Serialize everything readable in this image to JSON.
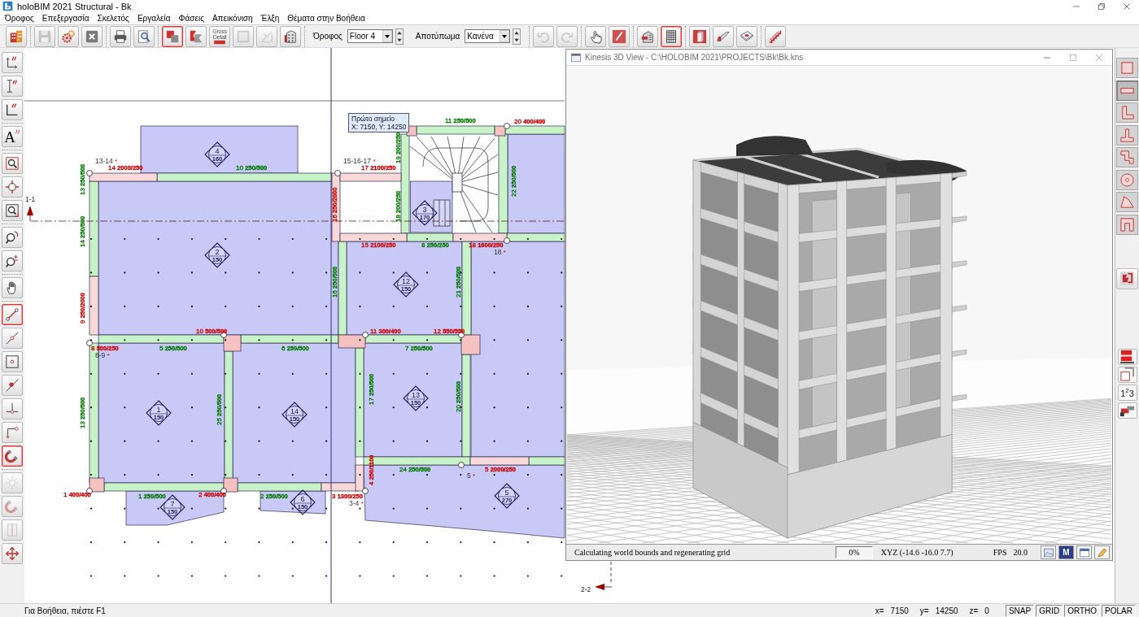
{
  "window": {
    "title": "holoBIM 2021 Structural - Bk"
  },
  "menu": [
    "Όροφος",
    "Επεξεργασία",
    "Σκελετός",
    "Εργαλεία",
    "Φάσεις",
    "Απεικόνιση",
    "Έλξη",
    "Θέματα στην Βοήθεια"
  ],
  "toolbar": [
    {
      "items": [
        {
          "kind": "building",
          "selected": false,
          "disabled": false
        }
      ]
    },
    {
      "items": [
        {
          "kind": "save",
          "selected": false,
          "disabled": true
        },
        {
          "kind": "gears",
          "selected": false,
          "disabled": false
        },
        {
          "kind": "delete",
          "selected": false,
          "disabled": false
        }
      ]
    },
    {
      "items": [
        {
          "kind": "print",
          "selected": false,
          "disabled": false
        },
        {
          "kind": "preview",
          "selected": false,
          "disabled": false
        }
      ]
    },
    {
      "items": [
        {
          "kind": "plan",
          "selected": true,
          "disabled": false
        },
        {
          "kind": "wedge",
          "selected": false,
          "disabled": false
        },
        {
          "kind": "gross",
          "label": "Gross Detail",
          "selected": false,
          "disabled": false
        },
        {
          "kind": "frame",
          "selected": false,
          "disabled": true
        },
        {
          "kind": "sketch",
          "selected": false,
          "disabled": true
        },
        {
          "kind": "facade",
          "selected": false,
          "disabled": false
        }
      ]
    },
    {
      "items": [
        {
          "kind": "combo",
          "label": "Όροφος",
          "value": "Floor 4"
        },
        {
          "kind": "combo",
          "label": "Αποτύπωμα",
          "value": "Κανένα"
        }
      ]
    },
    {
      "items": [
        {
          "kind": "undo",
          "selected": false,
          "disabled": true
        },
        {
          "kind": "redo",
          "selected": false,
          "disabled": true
        }
      ]
    },
    {
      "items": [
        {
          "kind": "hand",
          "selected": false,
          "disabled": false
        },
        {
          "kind": "pen",
          "selected": false,
          "disabled": false
        }
      ]
    },
    {
      "items": [
        {
          "kind": "section-view",
          "selected": false,
          "disabled": false
        },
        {
          "kind": "grid-view",
          "selected": true,
          "disabled": false
        }
      ]
    },
    {
      "items": [
        {
          "kind": "column",
          "selected": false,
          "disabled": false
        },
        {
          "kind": "beam",
          "selected": false,
          "disabled": false
        },
        {
          "kind": "slab",
          "selected": false,
          "disabled": false
        }
      ]
    },
    {
      "items": [
        {
          "kind": "stairs",
          "selected": false,
          "disabled": false
        }
      ]
    }
  ],
  "left_toolbar": [
    {
      "items": [
        {
          "kind": "dim-linear",
          "selected": false,
          "disabled": false
        },
        {
          "kind": "dim-vertical",
          "selected": false,
          "disabled": false
        },
        {
          "kind": "dim-angle",
          "selected": false,
          "disabled": false
        }
      ]
    },
    {
      "items": [
        {
          "kind": "text",
          "glyph": "A",
          "selected": false,
          "disabled": false
        }
      ]
    },
    {
      "items": [
        {
          "kind": "zoom-window",
          "selected": false,
          "disabled": false
        },
        {
          "kind": "zoom-center",
          "selected": false,
          "disabled": false
        },
        {
          "kind": "zoom-extents",
          "selected": false,
          "disabled": false
        }
      ]
    },
    {
      "items": [
        {
          "kind": "zoom-previous",
          "selected": false,
          "disabled": false
        },
        {
          "kind": "zoom-scale",
          "selected": false,
          "disabled": false
        }
      ]
    },
    {
      "items": [
        {
          "kind": "pan",
          "selected": false,
          "disabled": false
        }
      ]
    },
    {
      "items": [
        {
          "kind": "line",
          "selected": true,
          "disabled": false
        },
        {
          "kind": "line-mid",
          "selected": false,
          "disabled": false
        },
        {
          "kind": "center",
          "selected": false,
          "disabled": false
        },
        {
          "kind": "snap",
          "selected": false,
          "disabled": false
        },
        {
          "kind": "perpendicular",
          "selected": false,
          "disabled": false
        },
        {
          "kind": "corner",
          "selected": false,
          "disabled": false
        },
        {
          "kind": "magnet",
          "selected": true,
          "disabled": false
        }
      ]
    },
    {
      "items": [
        {
          "kind": "sun",
          "selected": false,
          "disabled": true
        },
        {
          "kind": "magnet-tool",
          "selected": false,
          "disabled": true
        },
        {
          "kind": "door",
          "selected": false,
          "disabled": true
        },
        {
          "kind": "move",
          "selected": false,
          "disabled": false
        }
      ]
    }
  ],
  "right_toolbar": [
    {
      "items": [
        {
          "kind": "rect-shape",
          "selected": false
        },
        {
          "kind": "bar-shape",
          "selected": true
        },
        {
          "kind": "l-shape",
          "selected": false
        },
        {
          "kind": "t-shape",
          "selected": false
        },
        {
          "kind": "z-shape",
          "selected": false
        },
        {
          "kind": "ring-shape",
          "selected": false
        },
        {
          "kind": "quad-shape",
          "selected": false
        },
        {
          "kind": "u-shape",
          "selected": false
        }
      ]
    },
    {
      "items": [
        {
          "kind": "section-cut",
          "selected": false
        }
      ]
    },
    {
      "items": [
        {
          "kind": "blocks",
          "selected": false
        },
        {
          "kind": "copy",
          "selected": false
        },
        {
          "kind": "numbering",
          "glyph": "1$^{2}$3",
          "selected": false
        },
        {
          "kind": "pipe",
          "selected": false
        }
      ]
    }
  ],
  "plan": {
    "sections": [
      "1-1",
      "2-2"
    ],
    "tooltip": {
      "title": "Πρώτο σημείο",
      "text": "X: 7150, Y: 14250"
    },
    "slabs": [
      {
        "number": "4",
        "thickness": "160"
      },
      {
        "number": "2",
        "thickness": "150"
      },
      {
        "number": "3",
        "thickness": "170"
      },
      {
        "number": "12",
        "thickness": "150"
      },
      {
        "number": "1",
        "thickness": "150"
      },
      {
        "number": "14",
        "thickness": "150"
      },
      {
        "number": "13",
        "thickness": "150"
      },
      {
        "number": "7",
        "thickness": "150"
      },
      {
        "number": "6",
        "thickness": "150"
      },
      {
        "number": "5",
        "thickness": "270"
      }
    ],
    "node_labels": [
      {
        "label": "13-14",
        "mark": "*"
      },
      {
        "label": "15-16-17",
        "mark": "*"
      },
      {
        "label": "8-9",
        "mark": "*"
      },
      {
        "label": "18",
        "mark": "*"
      },
      {
        "label": "5",
        "mark": "*"
      },
      {
        "label": "3-4",
        "mark": "*"
      }
    ],
    "member_labels": [
      {
        "number": "14",
        "size": "2000/250",
        "color": "#cc0000",
        "kind": "horizontal"
      },
      {
        "number": "10",
        "size": "250/500",
        "color": "#007a00",
        "kind": "horizontal"
      },
      {
        "number": "17",
        "size": "2100/250",
        "color": "#cc0000",
        "kind": "horizontal"
      },
      {
        "number": "11",
        "size": "250/500",
        "color": "#007a00",
        "kind": "horizontal"
      },
      {
        "number": "20",
        "size": "400/400",
        "color": "#cc0000",
        "kind": "horizontal"
      },
      {
        "number": "15",
        "size": "2100/250",
        "color": "#cc0000",
        "kind": "horizontal"
      },
      {
        "number": "8",
        "size": "250/250",
        "color": "#007a00",
        "kind": "horizontal"
      },
      {
        "number": "18",
        "size": "1600/250",
        "color": "#cc0000",
        "kind": "horizontal"
      },
      {
        "number": "10",
        "size": "500/500",
        "color": "#cc0000",
        "kind": "horizontal"
      },
      {
        "number": "11",
        "size": "300/400",
        "color": "#cc0000",
        "kind": "horizontal"
      },
      {
        "number": "12",
        "size": "550/550",
        "color": "#cc0000",
        "kind": "horizontal"
      },
      {
        "number": "8",
        "size": "500/250",
        "color": "#cc0000",
        "kind": "horizontal"
      },
      {
        "number": "5",
        "size": "250/500",
        "color": "#007a00",
        "kind": "horizontal"
      },
      {
        "number": "6",
        "size": "250/500",
        "color": "#007a00",
        "kind": "horizontal"
      },
      {
        "number": "7",
        "size": "250/500",
        "color": "#007a00",
        "kind": "horizontal"
      },
      {
        "number": "24",
        "size": "250/500",
        "color": "#007a00",
        "kind": "horizontal"
      },
      {
        "number": "5",
        "size": "2000/250",
        "color": "#cc0000",
        "kind": "horizontal"
      },
      {
        "number": "1",
        "size": "400/400",
        "color": "#cc0000",
        "kind": "horizontal"
      },
      {
        "number": "1",
        "size": "250/500",
        "color": "#007a00",
        "kind": "horizontal"
      },
      {
        "number": "2",
        "size": "400/400",
        "color": "#cc0000",
        "kind": "horizontal"
      },
      {
        "number": "2",
        "size": "250/500",
        "color": "#007a00",
        "kind": "horizontal"
      },
      {
        "number": "3",
        "size": "1300/250",
        "color": "#cc0000",
        "kind": "horizontal"
      },
      {
        "number": "13",
        "size": "250/500",
        "color": "#007a00",
        "kind": "vertical"
      },
      {
        "number": "19",
        "size": "200/250",
        "color": "#007a00",
        "kind": "vertical"
      },
      {
        "number": "22",
        "size": "250/500",
        "color": "#007a00",
        "kind": "vertical"
      },
      {
        "number": "16",
        "size": "250/2000",
        "color": "#cc0000",
        "kind": "vertical"
      },
      {
        "number": "18",
        "size": "200/250",
        "color": "#007a00",
        "kind": "vertical"
      },
      {
        "number": "14",
        "size": "250/500",
        "color": "#007a00",
        "kind": "vertical"
      },
      {
        "number": "9",
        "size": "250/2000",
        "color": "#cc0000",
        "kind": "vertical"
      },
      {
        "number": "16",
        "size": "250/500",
        "color": "#007a00",
        "kind": "vertical"
      },
      {
        "number": "21",
        "size": "250/500",
        "color": "#007a00",
        "kind": "vertical"
      },
      {
        "number": "13",
        "size": "250/500",
        "color": "#007a00",
        "kind": "vertical"
      },
      {
        "number": "25",
        "size": "250/500",
        "color": "#007a00",
        "kind": "vertical"
      },
      {
        "number": "17",
        "size": "250/500",
        "color": "#007a00",
        "kind": "vertical"
      },
      {
        "number": "20",
        "size": "250/500",
        "color": "#007a00",
        "kind": "vertical"
      },
      {
        "number": "4",
        "size": "250/1100",
        "color": "#cc0000",
        "kind": "vertical"
      }
    ]
  },
  "view3d": {
    "title": "Kinesis 3D View - C:\\HOLOBIM 2021\\PROJECTS\\Bk\\Bk.kns",
    "status": "Calculating world bounds and regenerating grid",
    "progress": "0%",
    "coordinates": "XYZ (-14.6 -16.0 7.7)",
    "fps_label": "FPS",
    "fps": "20.0",
    "buttons": [
      {
        "kind": "picture"
      },
      {
        "kind": "letter",
        "glyph": "M"
      },
      {
        "kind": "window"
      },
      {
        "kind": "pencil"
      }
    ]
  },
  "status_bar": {
    "help": "Για Βοήθεια, πιέστε F1",
    "coordinates": [
      {
        "label": "x=",
        "value": "7150"
      },
      {
        "label": "y=",
        "value": "14250"
      },
      {
        "label": "z=",
        "value": "0"
      }
    ],
    "modes": [
      "SNAP",
      "GRID",
      "ORTHO",
      "POLAR"
    ]
  }
}
